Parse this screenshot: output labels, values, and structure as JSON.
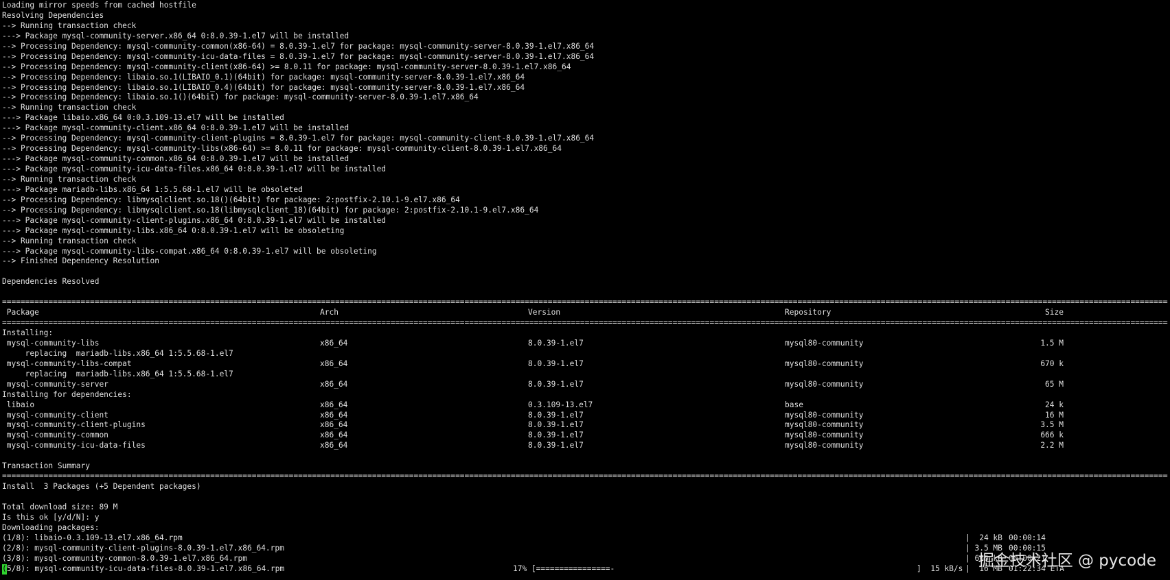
{
  "terminal": {
    "log_lines": [
      "Loading mirror speeds from cached hostfile",
      "Resolving Dependencies",
      "--> Running transaction check",
      "---> Package mysql-community-server.x86_64 0:8.0.39-1.el7 will be installed",
      "--> Processing Dependency: mysql-community-common(x86-64) = 8.0.39-1.el7 for package: mysql-community-server-8.0.39-1.el7.x86_64",
      "--> Processing Dependency: mysql-community-icu-data-files = 8.0.39-1.el7 for package: mysql-community-server-8.0.39-1.el7.x86_64",
      "--> Processing Dependency: mysql-community-client(x86-64) >= 8.0.11 for package: mysql-community-server-8.0.39-1.el7.x86_64",
      "--> Processing Dependency: libaio.so.1(LIBAIO_0.1)(64bit) for package: mysql-community-server-8.0.39-1.el7.x86_64",
      "--> Processing Dependency: libaio.so.1(LIBAIO_0.4)(64bit) for package: mysql-community-server-8.0.39-1.el7.x86_64",
      "--> Processing Dependency: libaio.so.1()(64bit) for package: mysql-community-server-8.0.39-1.el7.x86_64",
      "--> Running transaction check",
      "---> Package libaio.x86_64 0:0.3.109-13.el7 will be installed",
      "---> Package mysql-community-client.x86_64 0:8.0.39-1.el7 will be installed",
      "--> Processing Dependency: mysql-community-client-plugins = 8.0.39-1.el7 for package: mysql-community-client-8.0.39-1.el7.x86_64",
      "--> Processing Dependency: mysql-community-libs(x86-64) >= 8.0.11 for package: mysql-community-client-8.0.39-1.el7.x86_64",
      "---> Package mysql-community-common.x86_64 0:8.0.39-1.el7 will be installed",
      "---> Package mysql-community-icu-data-files.x86_64 0:8.0.39-1.el7 will be installed",
      "--> Running transaction check",
      "---> Package mariadb-libs.x86_64 1:5.5.68-1.el7 will be obsoleted",
      "--> Processing Dependency: libmysqlclient.so.18()(64bit) for package: 2:postfix-2.10.1-9.el7.x86_64",
      "--> Processing Dependency: libmysqlclient.so.18(libmysqlclient_18)(64bit) for package: 2:postfix-2.10.1-9.el7.x86_64",
      "---> Package mysql-community-client-plugins.x86_64 0:8.0.39-1.el7 will be installed",
      "---> Package mysql-community-libs.x86_64 0:8.0.39-1.el7 will be obsoleting",
      "--> Running transaction check",
      "---> Package mysql-community-libs-compat.x86_64 0:8.0.39-1.el7 will be obsoleting",
      "--> Finished Dependency Resolution",
      "",
      "Dependencies Resolved",
      ""
    ],
    "table": {
      "headers": {
        "package": " Package",
        "arch": "Arch",
        "version": "Version",
        "repository": "Repository",
        "size": "Size"
      },
      "section_installing": "Installing:",
      "installing": [
        {
          "package": " mysql-community-libs",
          "arch": "x86_64",
          "version": "8.0.39-1.el7",
          "repository": "mysql80-community",
          "size": "1.5 M"
        },
        {
          "replacing": "     replacing  mariadb-libs.x86_64 1:5.5.68-1.el7"
        },
        {
          "package": " mysql-community-libs-compat",
          "arch": "x86_64",
          "version": "8.0.39-1.el7",
          "repository": "mysql80-community",
          "size": "670 k"
        },
        {
          "replacing": "     replacing  mariadb-libs.x86_64 1:5.5.68-1.el7"
        },
        {
          "package": " mysql-community-server",
          "arch": "x86_64",
          "version": "8.0.39-1.el7",
          "repository": "mysql80-community",
          "size": "65 M"
        }
      ],
      "section_deps": "Installing for dependencies:",
      "dependencies": [
        {
          "package": " libaio",
          "arch": "x86_64",
          "version": "0.3.109-13.el7",
          "repository": "base",
          "size": "24 k"
        },
        {
          "package": " mysql-community-client",
          "arch": "x86_64",
          "version": "8.0.39-1.el7",
          "repository": "mysql80-community",
          "size": "16 M"
        },
        {
          "package": " mysql-community-client-plugins",
          "arch": "x86_64",
          "version": "8.0.39-1.el7",
          "repository": "mysql80-community",
          "size": "3.5 M"
        },
        {
          "package": " mysql-community-common",
          "arch": "x86_64",
          "version": "8.0.39-1.el7",
          "repository": "mysql80-community",
          "size": "666 k"
        },
        {
          "package": " mysql-community-icu-data-files",
          "arch": "x86_64",
          "version": "8.0.39-1.el7",
          "repository": "mysql80-community",
          "size": "2.2 M"
        }
      ]
    },
    "summary": {
      "title": "Transaction Summary",
      "install_line": "Install  3 Packages (+5 Dependent packages)",
      "total_size": "Total download size: 89 M",
      "prompt": "Is this ok [y/d/N]: y",
      "downloading": "Downloading packages:"
    },
    "downloads": [
      {
        "file": "(1/8): libaio-0.3.109-13.el7.x86_64.rpm",
        "size": "|  24 kB",
        "time": "00:00:14"
      },
      {
        "file": "(2/8): mysql-community-client-plugins-8.0.39-1.el7.x86_64.rpm",
        "size": "| 3.5 MB",
        "time": "00:00:15"
      },
      {
        "file": "(3/8): mysql-community-common-8.0.39-1.el7.x86_64.rpm",
        "size": "| 666 kB",
        "time": "00:00:21"
      }
    ],
    "progress": {
      "cursor_char": "(",
      "file": "5/8): mysql-community-icu-data-files-8.0.39-1.el7.x86_64.rpm",
      "percent_text": "17% [================-",
      "rate_text": "]  15 kB/s",
      "size_text": "|  16 MB",
      "eta_text": "01:22:34 ETA"
    }
  },
  "watermark": {
    "text": "掘金技术社区 @ pycode"
  },
  "colors": {
    "background": "#000000",
    "foreground": "#e0e0e0",
    "cursor": "#2fd32f"
  }
}
